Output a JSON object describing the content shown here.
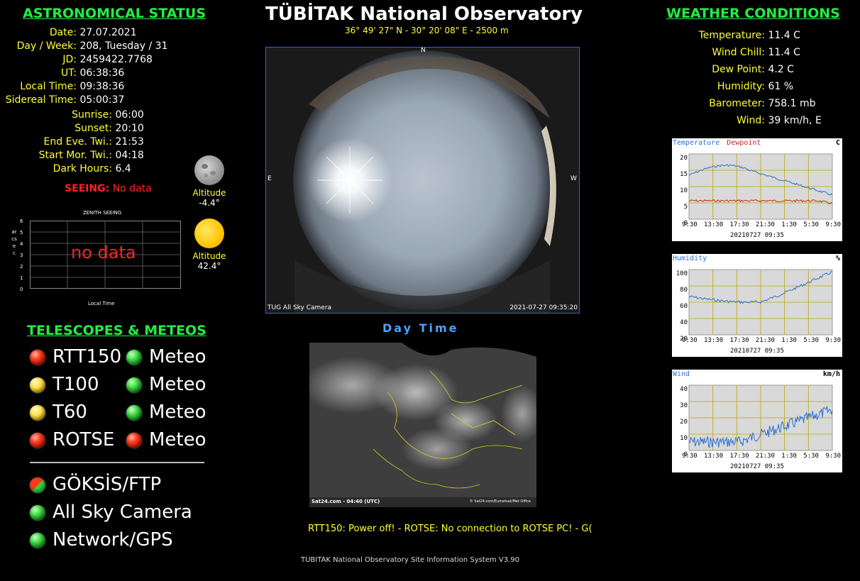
{
  "header": {
    "title": "TÜBİTAK National Observatory",
    "coords": "36° 49' 27\" N - 30° 20' 08\" E - 2500 m"
  },
  "astro": {
    "heading": "ASTRONOMICAL STATUS",
    "date_label": "Date:",
    "date": "27.07.2021",
    "dayweek_label": "Day / Week:",
    "dayweek": "208, Tuesday / 31",
    "jd_label": "JD:",
    "jd": "2459422.7768",
    "ut_label": "UT:",
    "ut": "06:38:36",
    "local_label": "Local Time:",
    "local": "09:38:36",
    "sidereal_label": "Sidereal Time:",
    "sidereal": "05:00:37",
    "sunrise_label": "Sunrise:",
    "sunrise": "06:00",
    "sunset_label": "Sunset:",
    "sunset": "20:10",
    "endtwi_label": "End Eve. Twi.:",
    "endtwi": "21:53",
    "starttwi_label": "Start Mor. Twi.:",
    "starttwi": "04:18",
    "dark_label": "Dark Hours:",
    "dark": "6.4",
    "seeing_label": "SEEING:",
    "seeing": "No data",
    "moon_alt_label": "Altitude",
    "moon_alt": "-4.4°",
    "sun_alt_label": "Altitude",
    "sun_alt": "42.4°"
  },
  "seeing_chart": {
    "title": "ZENITH SEEING",
    "ylabel": "arcsec",
    "xlabel": "Local Time",
    "no_data": "no data",
    "yticks": [
      "6",
      "5",
      "4",
      "3",
      "2",
      "1",
      "0"
    ]
  },
  "telescopes": {
    "heading": "TELESCOPES & METEOS",
    "rows": [
      {
        "name": "RTT150",
        "state": "red",
        "meteo": "Meteo",
        "meteo_state": "grn"
      },
      {
        "name": "T100",
        "state": "yel",
        "meteo": "Meteo",
        "meteo_state": "grn"
      },
      {
        "name": "T60",
        "state": "yel",
        "meteo": "Meteo",
        "meteo_state": "grn"
      },
      {
        "name": "ROTSE",
        "state": "red",
        "meteo": "Meteo",
        "meteo_state": "red"
      }
    ],
    "services": [
      {
        "name": "GÖKSİS/FTP",
        "state": "rg"
      },
      {
        "name": "All Sky Camera",
        "state": "grn"
      },
      {
        "name": "Network/GPS",
        "state": "grn"
      }
    ]
  },
  "allsky": {
    "compass_n": "N",
    "compass_e": "E",
    "compass_w": "W",
    "caption_left": "TUG All Sky Camera",
    "caption_right": "2021-07-27 09:35:20",
    "daytime": "Day Time"
  },
  "satellite": {
    "caption_left": "Sat24.com - 04:40 (UTC)",
    "caption_right": "© Sat24.com/Eumetsat/Met Office"
  },
  "ticker": "RTT150: Power off! - ROTSE: No connection to ROTSE PC! - G(",
  "footer": "TUBITAK National Observatory Site Information System V3.90",
  "weather": {
    "heading": "WEATHER CONDITIONS",
    "temp_label": "Temperature:",
    "temp": "11.4 C",
    "chill_label": "Wind Chill:",
    "chill": "11.4 C",
    "dew_label": "Dew Point:",
    "dew": "4.2 C",
    "hum_label": "Humidity:",
    "hum": "61 %",
    "baro_label": "Barometer:",
    "baro": "758.1 mb",
    "wind_label": "Wind:",
    "wind": "39 km/h, E"
  },
  "plots": {
    "temp": {
      "title1": "Temperature",
      "title2": "Dewpoint",
      "unit": "C",
      "yticks": [
        "20",
        "15",
        "10",
        "5",
        "0"
      ],
      "xticks": [
        "9:30",
        "13:30",
        "17:30",
        "21:30",
        "1:30",
        "5:30",
        "9:30"
      ],
      "stamp": "20210727 09:35"
    },
    "hum": {
      "title1": "Humidity",
      "unit": "%",
      "yticks": [
        "100",
        "80",
        "60",
        "40",
        "20"
      ],
      "xticks": [
        "9:30",
        "13:30",
        "17:30",
        "21:30",
        "1:30",
        "5:30",
        "9:30"
      ],
      "stamp": "20210727 09:35"
    },
    "wind": {
      "title1": "Wind",
      "unit": "km/h",
      "yticks": [
        "40",
        "30",
        "20",
        "10",
        "0"
      ],
      "xticks": [
        "9:30",
        "13:30",
        "17:30",
        "21:30",
        "1:30",
        "5:30",
        "9:30"
      ],
      "stamp": "20210727 09:35"
    }
  },
  "colors": {
    "accent_green": "#22ee44",
    "label_yellow": "#ffff33",
    "alert_red": "#ff2222",
    "sky_blue": "#4aa3ff"
  }
}
